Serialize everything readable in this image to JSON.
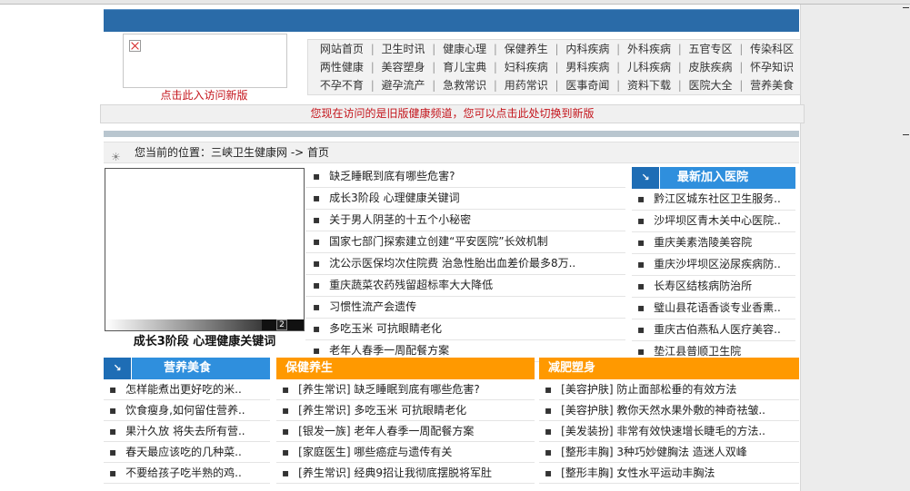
{
  "header": {
    "visit_new": "点击此入访问新版"
  },
  "nav": {
    "rows": [
      [
        "网站首页",
        "卫生时讯",
        "健康心理",
        "保健养生",
        "内科疾病",
        "外科疾病",
        "五官专区",
        "传染科区"
      ],
      [
        "两性健康",
        "美容塑身",
        "育儿宝典",
        "妇科疾病",
        "男科疾病",
        "儿科疾病",
        "皮肤疾病",
        "怀孕知识"
      ],
      [
        "不孕不育",
        "避孕流产",
        "急救常识",
        "用药常识",
        "医事奇闻",
        "资料下载",
        "医院大全",
        "营养美食"
      ]
    ]
  },
  "notice": "您现在访问的是旧版健康频道，您可以点击此处切换到新版",
  "breadcrumb": "您当前的位置：三峡卫生健康网 -> 首页",
  "photo": {
    "caption": "成长3阶段 心理健康关键词",
    "page": "2"
  },
  "news": [
    "缺乏睡眠到底有哪些危害?",
    "成长3阶段 心理健康关键词",
    "关于男人阴茎的十五个小秘密",
    "国家七部门探索建立创建“平安医院”长效机制",
    "沈公示医保均次住院费 治急性胎出血差价最多8万..",
    "重庆蔬菜农药残留超标率大大降低",
    "习惯性流产会遗传",
    "多吃玉米 可抗眼睛老化",
    "老年人春季一周配餐方案"
  ],
  "hospitals": {
    "title": "最新加入医院",
    "items": [
      "黔江区城东社区卫生服务..",
      "沙坪坝区青木关中心医院..",
      "重庆美素浩陵美容院",
      "重庆沙坪坝区泌尿疾病防..",
      "长寿区结核病防治所",
      "璧山县花语香谈专业香熏..",
      "重庆古伯燕私人医疗美容..",
      "垫江县普顺卫生院"
    ]
  },
  "food": {
    "title": "营养美食",
    "items": [
      "怎样能煮出更好吃的米..",
      "饮食瘦身,如何留住营养..",
      "果汁久放 将失去所有营..",
      "春天最应该吃的几种菜..",
      "不要给孩子吃半熟的鸡.."
    ]
  },
  "health": {
    "title": "保健养生",
    "items": [
      "[养生常识] 缺乏睡眠到底有哪些危害?",
      "[养生常识] 多吃玉米 可抗眼睛老化",
      "[银发一族] 老年人春季一周配餐方案",
      "[家庭医生] 哪些癌症与遗传有关",
      "[养生常识] 经典9招让我彻底摆脱将军肚"
    ]
  },
  "slim": {
    "title": "减肥塑身",
    "items": [
      "[美容护肤] 防止面部松垂的有效方法",
      "[美容护肤] 教你天然水果外敷的神奇祛皱..",
      "[美发装扮] 非常有效快速增长睫毛的方法..",
      "[整形丰胸] 3种巧妙健胸法 造迷人双峰",
      "[整形丰胸] 女性水平运动丰胸法"
    ]
  },
  "icons": {
    "arrow": "↘",
    "crumb": "☀"
  }
}
